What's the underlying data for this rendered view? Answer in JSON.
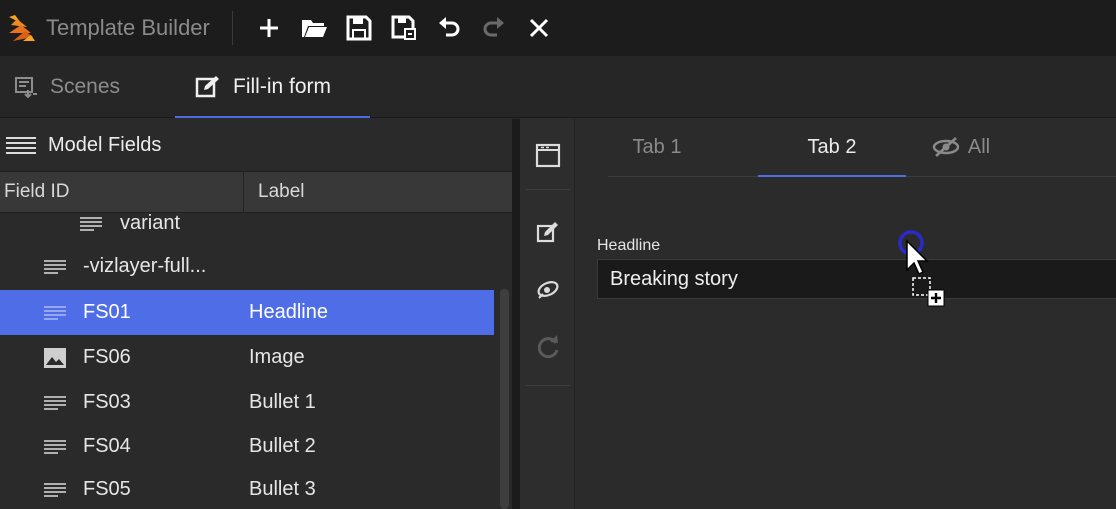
{
  "app": {
    "title": "Template Builder",
    "icons": [
      "app-logo",
      "new-icon",
      "open-folder-icon",
      "save-icon",
      "save-as-icon",
      "undo-icon",
      "redo-icon",
      "close-icon"
    ]
  },
  "mode_tabs": [
    {
      "label": "Scenes",
      "icon": "scenes-icon",
      "active": false
    },
    {
      "label": "Fill-in form",
      "icon": "edit-form-icon",
      "active": true
    }
  ],
  "model_fields": {
    "title": "Model Fields",
    "columns": {
      "id": "Field ID",
      "label": "Label"
    },
    "rows": [
      {
        "id": "variant",
        "label": "",
        "icon": "text-lines-icon"
      },
      {
        "id": "-vizlayer-full...",
        "label": "",
        "icon": "text-lines-icon"
      },
      {
        "id": "FS01",
        "label": "Headline",
        "icon": "text-lines-icon",
        "selected": true
      },
      {
        "id": "FS06",
        "label": "Image",
        "icon": "image-icon"
      },
      {
        "id": "FS03",
        "label": "Bullet 1",
        "icon": "text-lines-icon"
      },
      {
        "id": "FS04",
        "label": "Bullet 2",
        "icon": "text-lines-icon"
      },
      {
        "id": "FS05",
        "label": "Bullet 3",
        "icon": "text-lines-icon"
      }
    ]
  },
  "vertical_toolbar": [
    "frame-icon",
    "edit-icon",
    "preview-eye-icon",
    "refresh-icon"
  ],
  "form": {
    "tabs": [
      {
        "label": "Tab 1",
        "active": false
      },
      {
        "label": "Tab 2",
        "active": true
      },
      {
        "label": "All",
        "active": false,
        "icon": "hidden-eye-icon"
      }
    ],
    "field": {
      "label": "Headline",
      "value": "Breaking story"
    }
  },
  "colors": {
    "accent": "#4b6de0",
    "selection": "#4e6de6",
    "logo": "#f08a24"
  }
}
